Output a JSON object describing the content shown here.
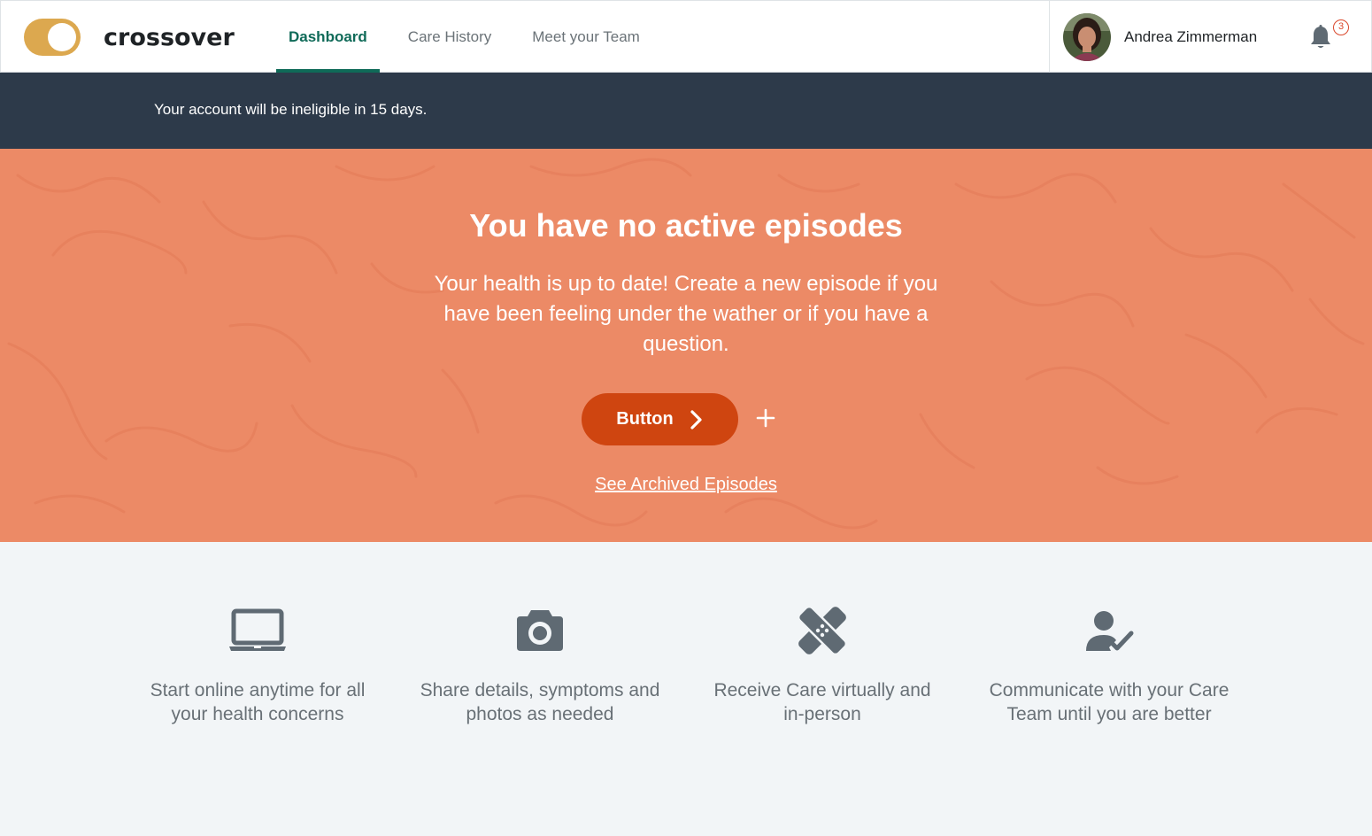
{
  "brand": {
    "name": "crossover",
    "toggle_color": "#dca84f"
  },
  "nav": {
    "tabs": [
      {
        "label": "Dashboard",
        "active": true
      },
      {
        "label": "Care History",
        "active": false
      },
      {
        "label": "Meet your Team",
        "active": false
      }
    ],
    "accent_color": "#0f6a58"
  },
  "user": {
    "name": "Andrea Zimmerman",
    "avatar_icon": "avatar-photo",
    "notifications_icon": "bell-icon",
    "notification_count": "3"
  },
  "notice": {
    "text": "Your account will be ineligible in 15 days."
  },
  "hero": {
    "title": "You have no active episodes",
    "subtitle": "Your health is up to date! Create a new episode if you have been feeling under the wather or if you have a question.",
    "button_label": "Button",
    "archived_link": "See Archived Episodes",
    "background_color": "#ec8a66",
    "button_color": "#cf4510"
  },
  "features": [
    {
      "icon": "laptop-icon",
      "text": "Start online anytime for all your health concerns"
    },
    {
      "icon": "camera-icon",
      "text": "Share details, symptoms and photos as needed"
    },
    {
      "icon": "bandage-icon",
      "text": "Receive Care virtually and in-person"
    },
    {
      "icon": "user-check-icon",
      "text": "Communicate with your Care Team until you are better"
    }
  ]
}
